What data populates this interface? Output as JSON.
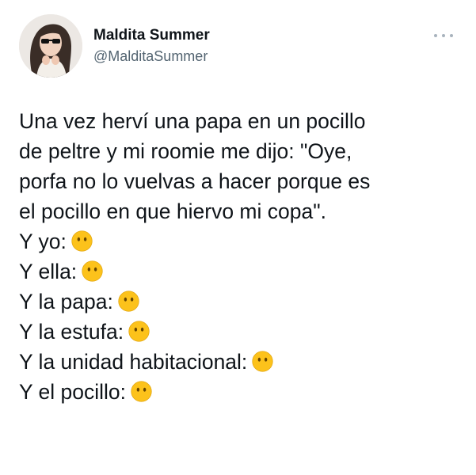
{
  "tweet": {
    "author": {
      "display_name": "Maldita Summer",
      "handle": "@MalditaSummer"
    },
    "more_icon": "more-options-icon",
    "lines": [
      {
        "text": "Una vez herví una papa en un pocillo",
        "emoji": null
      },
      {
        "text": "de peltre y mi roomie me dijo: \"Oye,",
        "emoji": null
      },
      {
        "text": "porfa no lo vuelvas a hacer porque es",
        "emoji": null
      },
      {
        "text": "el pocillo en que hiervo mi copa\".",
        "emoji": null
      },
      {
        "text": "Y yo:",
        "emoji": "face-without-mouth-emoji"
      },
      {
        "text": "Y ella:",
        "emoji": "face-without-mouth-emoji"
      },
      {
        "text": "Y la papa:",
        "emoji": "face-without-mouth-emoji"
      },
      {
        "text": "Y la estufa:",
        "emoji": "face-without-mouth-emoji"
      },
      {
        "text": "Y la unidad habitacional:",
        "emoji": "face-without-mouth-emoji"
      },
      {
        "text": "Y el pocillo:",
        "emoji": "face-without-mouth-emoji"
      }
    ]
  },
  "colors": {
    "text": "#0f1419",
    "secondary_text": "#536471",
    "emoji_face": "#fcc21b"
  }
}
